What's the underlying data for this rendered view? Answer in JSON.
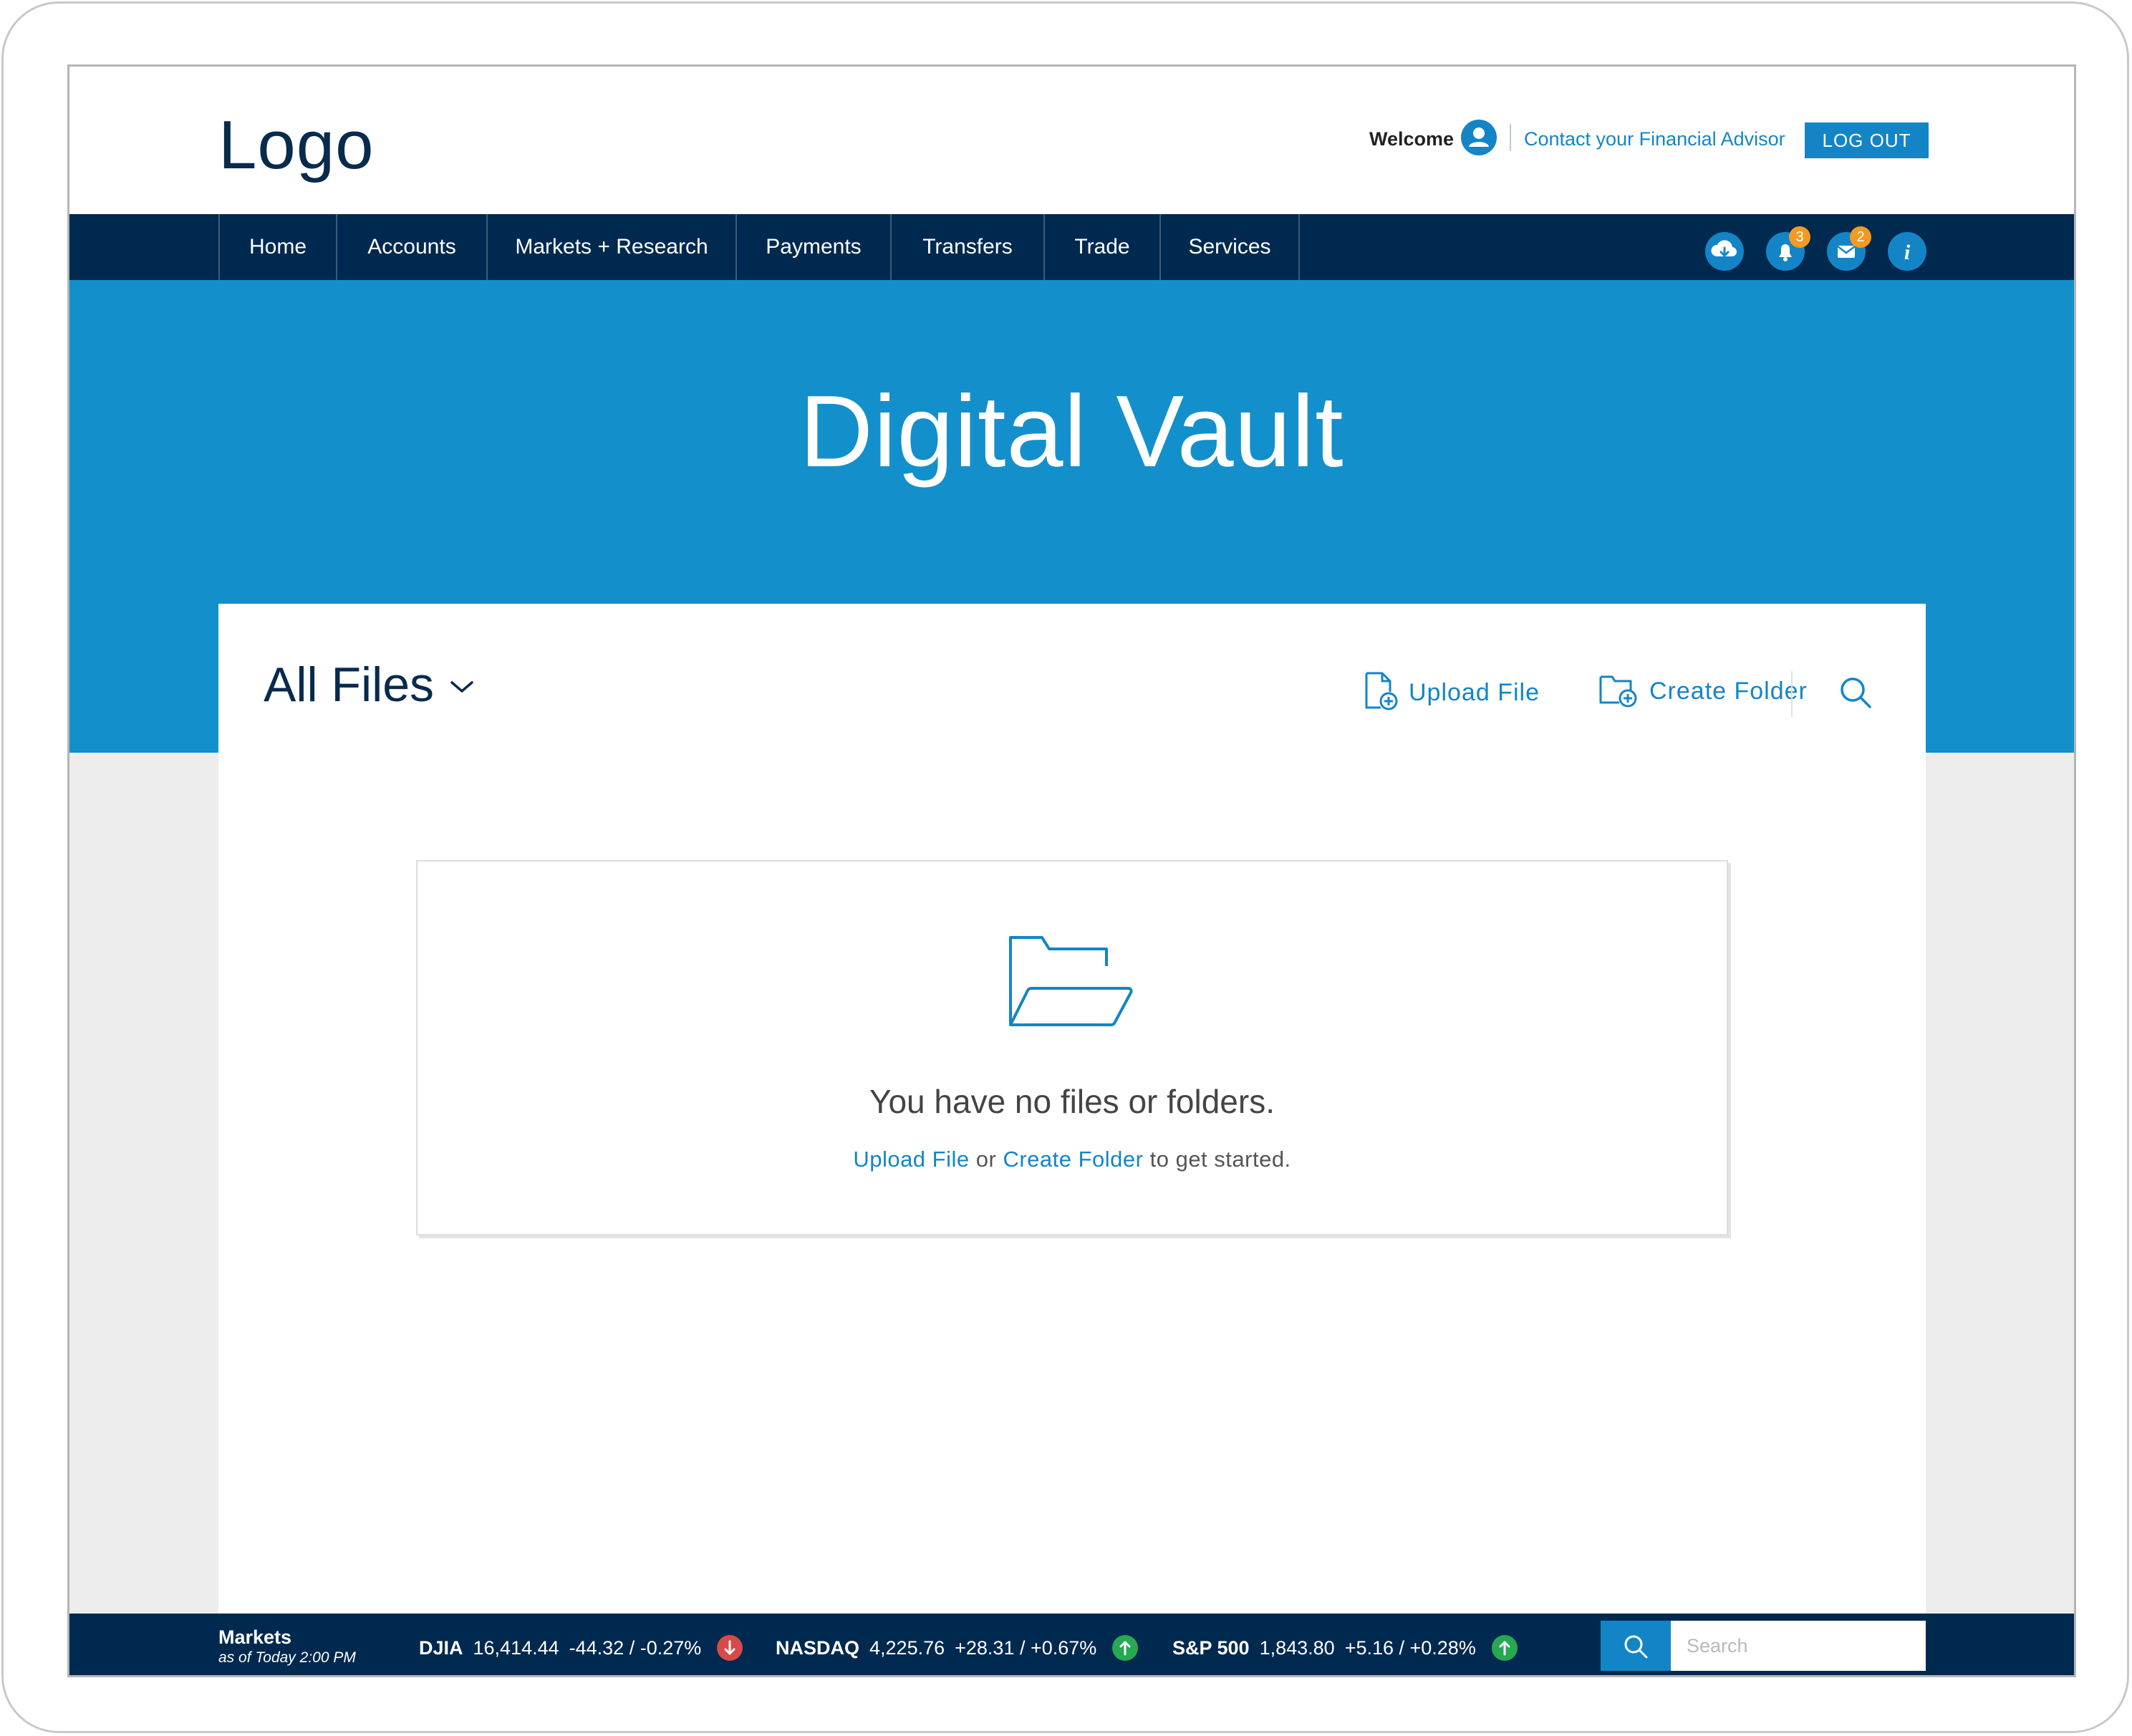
{
  "header": {
    "logo": "Logo",
    "welcome": "Welcome",
    "user_icon": "user-icon",
    "advisor_link": "Contact your Financial Advisor",
    "logout_label": "LOG OUT"
  },
  "nav": {
    "items": [
      {
        "label": "Home"
      },
      {
        "label": "Accounts"
      },
      {
        "label": "Markets + Research"
      },
      {
        "label": "Payments"
      },
      {
        "label": "Transfers"
      },
      {
        "label": "Trade"
      },
      {
        "label": "Services"
      }
    ],
    "icons": [
      {
        "name": "cloud-download-icon",
        "badge": ""
      },
      {
        "name": "bell-icon",
        "badge": "3"
      },
      {
        "name": "mail-icon",
        "badge": "2"
      },
      {
        "name": "info-icon",
        "badge": ""
      }
    ]
  },
  "hero": {
    "title": "Digital Vault"
  },
  "files": {
    "title": "All Files",
    "upload_label": "Upload File",
    "create_folder_label": "Create Folder",
    "empty_message": "You have no files or folders.",
    "empty_sub_upload": "Upload File",
    "empty_sub_or": "or",
    "empty_sub_create": "Create Folder",
    "empty_sub_suffix": "to get started."
  },
  "markets": {
    "title": "Markets",
    "as_of": "as of Today 2:00 PM",
    "tickers": [
      {
        "name": "DJIA",
        "value": "16,414.44",
        "change": "-44.32 / -0.27%",
        "direction": "down"
      },
      {
        "name": "NASDAQ",
        "value": "4,225.76",
        "change": "+28.31 / +0.67%",
        "direction": "up"
      },
      {
        "name": "S&P 500",
        "value": "1,843.80",
        "change": "+5.16 / +0.28%",
        "direction": "up"
      }
    ],
    "search_placeholder": "Search"
  },
  "colors": {
    "brand_blue": "#1385c7",
    "hero_blue": "#1390cb",
    "navy": "#00294f",
    "badge_orange": "#f29a22",
    "down_red": "#d64a48",
    "up_green": "#27a853"
  }
}
